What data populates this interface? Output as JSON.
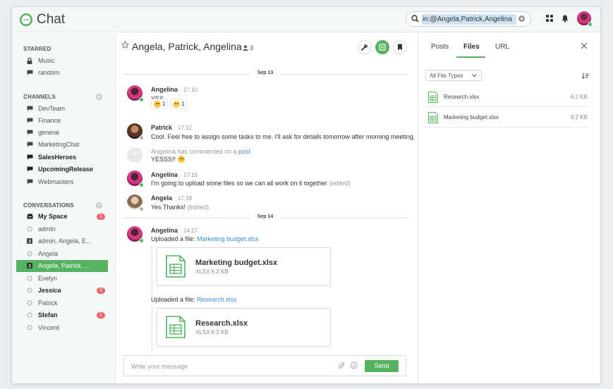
{
  "app": {
    "title": "Chat"
  },
  "search": {
    "value": "in:@Angela,Patrick,Angelina"
  },
  "colors": {
    "accent": "#54b260",
    "badge": "#f0616b",
    "link": "#3a8fd6"
  },
  "sidebar": {
    "starred_header": "STARRED",
    "starred": [
      {
        "label": "Music",
        "icon": "lock-icon"
      },
      {
        "label": "random",
        "icon": "chat-icon"
      }
    ],
    "channels_header": "CHANNELS",
    "channels": [
      {
        "label": "DevTeam",
        "bold": false
      },
      {
        "label": "Finance",
        "bold": false
      },
      {
        "label": "general",
        "bold": false
      },
      {
        "label": "MarketingChat",
        "bold": false
      },
      {
        "label": "SalesHeroes",
        "bold": true
      },
      {
        "label": "UpcomingRelease",
        "bold": true
      },
      {
        "label": "Webmasters",
        "bold": false
      }
    ],
    "conversations_header": "CONVERSATIONS",
    "conversations": [
      {
        "label": "My Space",
        "bold": true,
        "badge": "1",
        "icon": "inbox-icon"
      },
      {
        "label": "admin",
        "bold": false,
        "icon": "status-circle-icon"
      },
      {
        "label": "admin, Angela, E...",
        "bold": false,
        "icon": "group-icon"
      },
      {
        "label": "Angela",
        "bold": false,
        "icon": "status-circle-icon"
      },
      {
        "label": "Angela, Patrick, ...",
        "bold": false,
        "active": true,
        "icon": "group-icon"
      },
      {
        "label": "Evelyn",
        "bold": false,
        "icon": "status-circle-icon"
      },
      {
        "label": "Jessica",
        "bold": true,
        "badge": "3",
        "icon": "status-circle-icon"
      },
      {
        "label": "Patrick",
        "bold": false,
        "icon": "status-circle-icon"
      },
      {
        "label": "Stefan",
        "bold": true,
        "badge": "1",
        "icon": "status-circle-icon"
      },
      {
        "label": "Vincent",
        "bold": false,
        "icon": "status-circle-icon"
      }
    ]
  },
  "chat": {
    "title": "Angela, Patrick, Angelina",
    "member_count": "3",
    "date1": "Sep 13",
    "date2": "Sep 14",
    "messages": [
      {
        "author": "Angelina",
        "time": "17:10",
        "text": "YES",
        "reactions": [
          {
            "emoji": "grin-emoji",
            "count": "1"
          },
          {
            "emoji": "smile-emoji",
            "count": "1"
          }
        ]
      },
      {
        "author": "Patrick",
        "time": "17:12",
        "text": "Cool. Feel free to assign some tasks to me. I'll ask for details tomorrow after morning meeting."
      },
      {
        "author": "Angelina",
        "action": "has commented on a",
        "link": "post",
        "text": "YESSS!!"
      },
      {
        "author": "Angelina",
        "time": "17:16",
        "text": "I'm going to upload some files so we can all work on it together",
        "edited": "(edited)"
      },
      {
        "author": "Angela",
        "time": "17:18",
        "text": "Yes Thanks!",
        "edited": "(edited)"
      },
      {
        "author": "Angelina",
        "time": "14:27",
        "uploads": [
          {
            "prefix": "Uploaded a file:",
            "file": "Marketing budget.xlsx",
            "card_name": "Marketing budget.xlsx",
            "card_meta": "XLSX 6.2 KB"
          },
          {
            "prefix": "Uploaded a file:",
            "file": "Research.xlsx",
            "card_name": "Research.xlsx",
            "card_meta": "XLSX 6.2 KB"
          }
        ]
      }
    ],
    "composer_placeholder": "Write your message",
    "send_label": "Send"
  },
  "right_panel": {
    "tabs": [
      "Posts",
      "Files",
      "URL"
    ],
    "active_tab": "Files",
    "filter": "All File Types",
    "files": [
      {
        "name": "Research.xlsx",
        "size": "6.2 KB"
      },
      {
        "name": "Marketing budget.xlsx",
        "size": "6.2 KB"
      }
    ]
  }
}
